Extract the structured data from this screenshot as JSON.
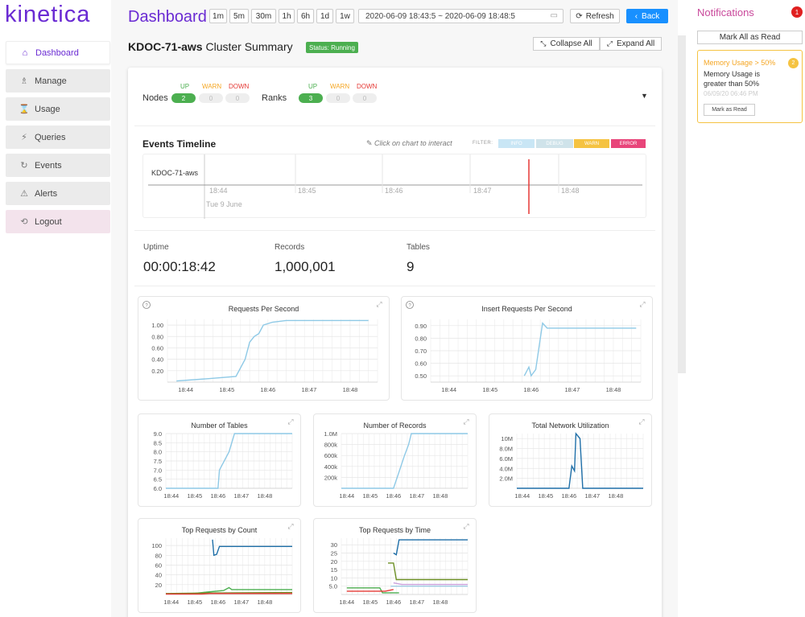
{
  "app": {
    "logo": "kinetica"
  },
  "sidebar": {
    "items": [
      {
        "label": "Dashboard",
        "icon": "home-icon",
        "glyph": "⌂"
      },
      {
        "label": "Manage",
        "icon": "manage-icon",
        "glyph": "♗"
      },
      {
        "label": "Usage",
        "icon": "usage-icon",
        "glyph": "⌛"
      },
      {
        "label": "Queries",
        "icon": "queries-icon",
        "glyph": "⚡"
      },
      {
        "label": "Events",
        "icon": "events-icon",
        "glyph": "↻"
      },
      {
        "label": "Alerts",
        "icon": "alerts-icon",
        "glyph": "⚠"
      },
      {
        "label": "Logout",
        "icon": "logout-icon",
        "glyph": "⟲"
      }
    ]
  },
  "header": {
    "title": "Dashboard",
    "ranges": [
      "1m",
      "5m",
      "30m",
      "1h",
      "6h",
      "1d",
      "1w"
    ],
    "date_range": "2020-06-09 18:43:5 ~ 2020-06-09 18:48:5",
    "refresh": "Refresh",
    "back": "Back"
  },
  "cluster": {
    "name": "KDOC-71-aws",
    "suffix": "Cluster Summary",
    "status": "Status: Running",
    "collapse": "Collapse All",
    "expand": "Expand All"
  },
  "health": {
    "up": "UP",
    "warn": "WARN",
    "down": "DOWN",
    "nodes": {
      "label": "Nodes",
      "up": "2",
      "warn": "0",
      "down": "0"
    },
    "ranks": {
      "label": "Ranks",
      "up": "3",
      "warn": "0",
      "down": "0"
    }
  },
  "timeline": {
    "title": "Events Timeline",
    "hint": "Click on chart to interact",
    "filter_label": "FILTER:",
    "filters": [
      "INFO",
      "DEBUG",
      "WARN",
      "ERROR"
    ],
    "filter_colors": [
      "#c9e6f5",
      "#cfe3ea",
      "#f5c342",
      "#e8457a"
    ],
    "row": "KDOC-71-aws",
    "ticks": [
      "18:44",
      "18:45",
      "18:46",
      "18:47",
      "18:48"
    ],
    "date": "Tue 9 June"
  },
  "stats": {
    "uptime_label": "Uptime",
    "uptime": "00:00:18:42",
    "records_label": "Records",
    "records": "1,000,001",
    "tables_label": "Tables",
    "tables": "9"
  },
  "colors": {
    "accent": "#6a2bd3",
    "line": "#8ec9e6",
    "dark": "#1f6fa8",
    "green": "#4caf50",
    "red": "#e53935",
    "olive": "#6b8e23"
  },
  "chart_data": [
    {
      "type": "line",
      "title": "Requests Per Second",
      "x": [
        "18:44",
        "18:45",
        "18:46",
        "18:47",
        "18:48"
      ],
      "yticks": [
        "1.00",
        "0.80",
        "0.60",
        "0.40",
        "0.20"
      ],
      "ylim": [
        0,
        1.1
      ],
      "series": [
        {
          "points": [
            [
              0.2,
              0.02
            ],
            [
              0.9,
              0.06
            ],
            [
              1.5,
              0.1
            ],
            [
              1.7,
              0.4
            ],
            [
              1.8,
              0.7
            ],
            [
              1.9,
              0.8
            ],
            [
              2.0,
              0.85
            ],
            [
              2.1,
              1.0
            ],
            [
              2.3,
              1.05
            ],
            [
              2.6,
              1.08
            ],
            [
              3.0,
              1.08
            ],
            [
              4.4,
              1.08
            ]
          ]
        }
      ]
    },
    {
      "type": "line",
      "title": "Insert Requests Per Second",
      "x": [
        "18:44",
        "18:45",
        "18:46",
        "18:47",
        "18:48"
      ],
      "yticks": [
        "0.90",
        "0.80",
        "0.70",
        "0.60",
        "0.50"
      ],
      "ylim": [
        0.45,
        0.95
      ],
      "series": [
        {
          "points": [
            [
              2.05,
              0.5
            ],
            [
              2.15,
              0.57
            ],
            [
              2.2,
              0.5
            ],
            [
              2.3,
              0.55
            ],
            [
              2.45,
              0.92
            ],
            [
              2.55,
              0.88
            ],
            [
              3.0,
              0.88
            ],
            [
              4.5,
              0.88
            ]
          ]
        }
      ]
    },
    {
      "type": "line",
      "title": "Number of Tables",
      "x": [
        "18:44",
        "18:45",
        "18:46",
        "18:47",
        "18:48"
      ],
      "yticks": [
        "9.0",
        "8.5",
        "8.0",
        "7.5",
        "7.0",
        "6.5",
        "6.0"
      ],
      "ylim": [
        6,
        9
      ],
      "series": [
        {
          "points": [
            [
              0,
              6
            ],
            [
              1.9,
              6
            ],
            [
              1.95,
              7
            ],
            [
              2.3,
              8
            ],
            [
              2.5,
              9
            ],
            [
              4.6,
              9
            ]
          ]
        }
      ]
    },
    {
      "type": "line",
      "title": "Number of Records",
      "x": [
        "18:44",
        "18:45",
        "18:46",
        "18:47",
        "18:48"
      ],
      "yticks": [
        "1.0M",
        "800k",
        "600k",
        "400k",
        "200k"
      ],
      "ylim": [
        0,
        1000000
      ],
      "series": [
        {
          "points": [
            [
              0,
              0
            ],
            [
              1.9,
              0
            ],
            [
              2.1,
              300000
            ],
            [
              2.3,
              600000
            ],
            [
              2.45,
              800000
            ],
            [
              2.55,
              1000000
            ],
            [
              4.6,
              1000000
            ]
          ]
        }
      ]
    },
    {
      "type": "line",
      "title": "Total Network Utilization",
      "x": [
        "18:44",
        "18:45",
        "18:46",
        "18:47",
        "18:48"
      ],
      "yticks": [
        "10M",
        "8.0M",
        "6.0M",
        "4.0M",
        "2.0M"
      ],
      "ylim": [
        0,
        11000000
      ],
      "series": [
        {
          "points": [
            [
              0,
              0
            ],
            [
              1.9,
              0
            ],
            [
              2.0,
              4500000
            ],
            [
              2.1,
              3500000
            ],
            [
              2.15,
              11000000
            ],
            [
              2.3,
              10000000
            ],
            [
              2.4,
              0
            ],
            [
              4.6,
              0
            ]
          ]
        }
      ]
    },
    {
      "type": "line",
      "title": "Top Requests by Count",
      "x": [
        "18:44",
        "18:45",
        "18:46",
        "18:47",
        "18:48"
      ],
      "yticks": [
        "100",
        "80",
        "60",
        "40",
        "20"
      ],
      "ylim": [
        0,
        115
      ],
      "series": [
        {
          "color": "#1f6fa8",
          "points": [
            [
              1.7,
              112
            ],
            [
              1.75,
              80
            ],
            [
              1.85,
              82
            ],
            [
              1.95,
              98
            ],
            [
              4.6,
              98
            ]
          ]
        },
        {
          "color": "#4caf50",
          "points": [
            [
              1.0,
              2
            ],
            [
              1.5,
              5
            ],
            [
              2.1,
              8
            ],
            [
              2.3,
              14
            ],
            [
              2.4,
              10
            ],
            [
              4.6,
              10
            ]
          ]
        },
        {
          "color": "#6b8e23",
          "points": [
            [
              0,
              2
            ],
            [
              1.5,
              3
            ],
            [
              4.6,
              4
            ]
          ]
        },
        {
          "color": "#e53935",
          "points": [
            [
              0,
              1
            ],
            [
              1.3,
              1
            ],
            [
              1.6,
              2
            ],
            [
              4.6,
              2
            ]
          ]
        }
      ]
    },
    {
      "type": "line",
      "title": "Top Requests by Time",
      "x": [
        "18:44",
        "18:45",
        "18:46",
        "18:47",
        "18:48"
      ],
      "yticks": [
        "30",
        "25",
        "20",
        "15",
        "10",
        "5.0"
      ],
      "ylim": [
        0,
        34
      ],
      "series": [
        {
          "color": "#1f6fa8",
          "points": [
            [
              1.9,
              25
            ],
            [
              2.0,
              24
            ],
            [
              2.1,
              33
            ],
            [
              4.6,
              33
            ]
          ]
        },
        {
          "color": "#6b8e23",
          "points": [
            [
              1.7,
              19
            ],
            [
              1.9,
              19
            ],
            [
              2.0,
              9
            ],
            [
              4.6,
              9
            ]
          ]
        },
        {
          "color": "#4caf50",
          "points": [
            [
              0.2,
              4
            ],
            [
              1.4,
              4
            ],
            [
              1.5,
              1
            ],
            [
              2.1,
              1
            ]
          ]
        },
        {
          "color": "#e53935",
          "points": [
            [
              0.2,
              2
            ],
            [
              1.6,
              2
            ],
            [
              1.9,
              3
            ]
          ]
        },
        {
          "color": "#9ecae1",
          "points": [
            [
              1.8,
              5
            ],
            [
              4.6,
              5
            ]
          ]
        },
        {
          "color": "#c9a0dc",
          "points": [
            [
              1.9,
              7
            ],
            [
              2.2,
              6
            ],
            [
              4.6,
              6
            ]
          ]
        }
      ]
    }
  ],
  "notifications": {
    "title": "Notifications",
    "count": "1",
    "mark_all": "Mark All as Read",
    "items": [
      {
        "title": "Memory Usage > 50%",
        "badge": "2",
        "body": "Memory Usage is greater than 50%",
        "date": "06/09/20 06:46 PM",
        "action": "Mark as Read"
      }
    ]
  }
}
